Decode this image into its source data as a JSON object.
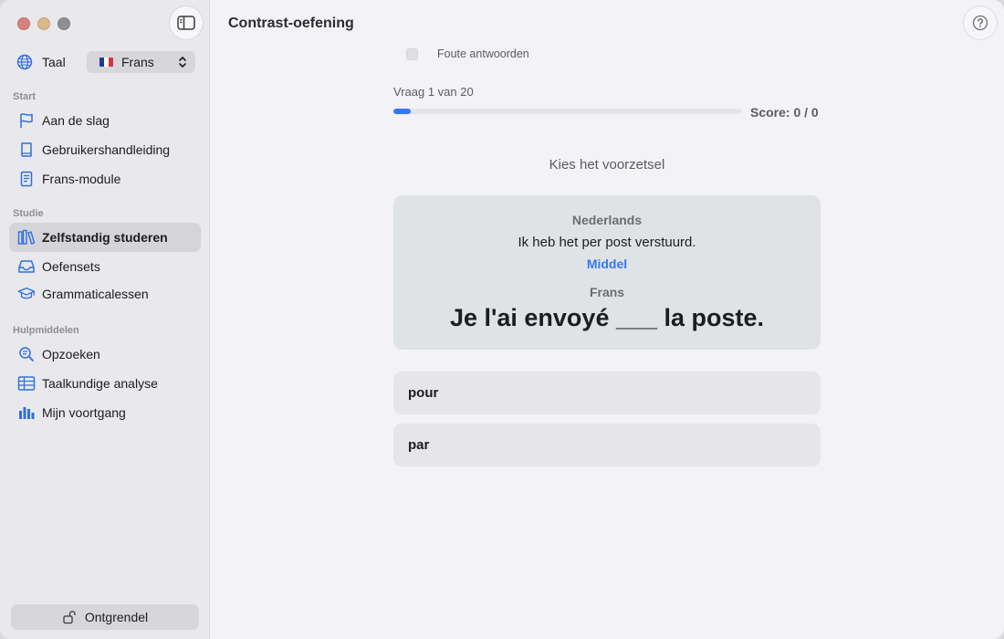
{
  "sidebar": {
    "language_label": "Taal",
    "language_value": "Frans",
    "sections": {
      "start": "Start",
      "studie": "Studie",
      "hulpmiddelen": "Hulpmiddelen"
    },
    "items": [
      {
        "label": "Aan de slag",
        "icon": "flag-icon"
      },
      {
        "label": "Gebruikershandleiding",
        "icon": "book-icon"
      },
      {
        "label": "Frans-module",
        "icon": "module-icon"
      },
      {
        "label": "Zelfstandig studeren",
        "icon": "library-icon",
        "active": true
      },
      {
        "label": "Oefensets",
        "icon": "tray-icon"
      },
      {
        "label": "Grammaticalessen",
        "icon": "graduation-cap-icon"
      },
      {
        "label": "Opzoeken",
        "icon": "magnifier-icon"
      },
      {
        "label": "Taalkundige analyse",
        "icon": "table-icon"
      },
      {
        "label": "Mijn voortgang",
        "icon": "bar-chart-icon"
      }
    ],
    "unlock_label": "Ontgrendel"
  },
  "main": {
    "title": "Contrast-oefening",
    "wrong_answers_label": "Foute antwoorden",
    "question_counter": "Vraag 1 van 20",
    "progress": 0.05,
    "score": "Score: 0 / 0",
    "instruction": "Kies het voorzetsel",
    "card": {
      "source_language": "Nederlands",
      "source_sentence": "Ik heb het per post verstuurd.",
      "level": "Middel",
      "target_language": "Frans",
      "target_sentence": "Je l'ai envoyé ___ la poste."
    },
    "options": [
      "pour",
      "par"
    ]
  },
  "colors": {
    "accent": "#3478f6",
    "sidebar_bg": "#e8e8ed",
    "main_bg": "#f2f2f7",
    "card_bg": "#dfe3e6"
  }
}
